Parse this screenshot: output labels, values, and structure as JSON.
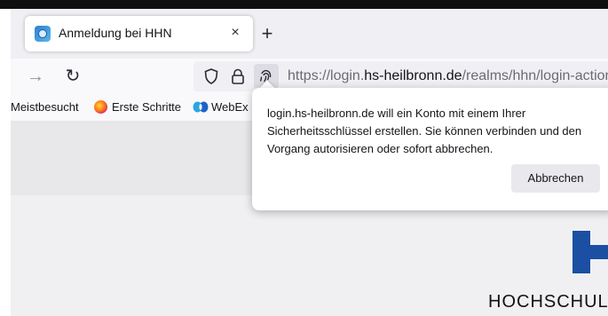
{
  "tab": {
    "title": "Anmeldung bei HHN",
    "close_glyph": "×",
    "favicon_icon": "hhn-favicon-icon"
  },
  "newtab_glyph": "+",
  "nav": {
    "back_glyph": "→",
    "reload_glyph": "↻",
    "url_prefix": "https://login.",
    "url_host": "hs-heilbronn.de",
    "url_path": "/realms/hhn/login-actions"
  },
  "bookmarks": [
    {
      "label": "Meistbesucht"
    },
    {
      "label": "Erste Schritte",
      "icon": "firefox-icon"
    },
    {
      "label": "WebEx I",
      "icon": "webex-icon"
    }
  ],
  "popup": {
    "message": "login.hs-heilbronn.de will ein Konto mit einem Ihrer Sicherheitsschlüssel erstellen. Sie können verbinden und den Vorgang autorisieren oder sofort abbrechen.",
    "cancel_label": "Abbrechen"
  },
  "page": {
    "logo_text": "HOCHSCHULE"
  },
  "colors": {
    "accent": "#1a4fa3",
    "toolbar": "#f9f9fb",
    "tabstrip": "#f0f0f4"
  }
}
